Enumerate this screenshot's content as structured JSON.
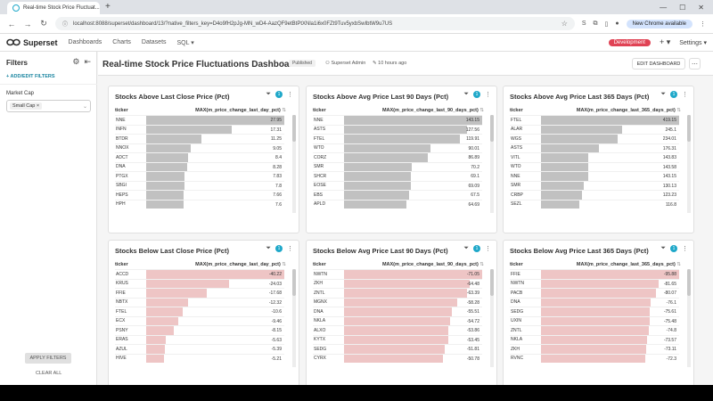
{
  "browser": {
    "tab_title": "Real-time Stock Price Fluctuat...",
    "url": "localhost:8088/superset/dashboard/13/?native_filters_key=D4o9fH2pJg-MN_wD4-AazQF9etBtPtXNla1i6x0FZt9Tuv5yxbSwIbtW9u7US",
    "new_chrome_label": "New Chrome available"
  },
  "superset": {
    "brand": "Superset",
    "menu": [
      "Dashboards",
      "Charts",
      "Datasets",
      "SQL ▾"
    ],
    "dev_badge": "Development",
    "plus_label": "+ ▾",
    "settings_label": "Settings ▾"
  },
  "filters_panel": {
    "title": "Filters",
    "add_edit": "+  ADD/EDIT FILTERS",
    "market_cap_label": "Market Cap",
    "selected_tag": "Small Cap ×",
    "apply_label": "APPLY FILTERS",
    "clear_label": "CLEAR ALL"
  },
  "dashboard": {
    "title": "Real-time Stock Price Fluctuations Dashboard",
    "status": "Published",
    "owner": "Superset Admin",
    "modified": "10 hours ago",
    "edit_label": "EDIT DASHBOARD",
    "more_label": "⋯"
  },
  "colors": {
    "positive_bar": "#c1c1c1",
    "negative_bar": "#eec5c5",
    "accent": "#1fa8c9",
    "dev_badge": "#e04355"
  },
  "charts": [
    {
      "title": "Stocks Above Last Close Price (Pct)",
      "col_ticker": "ticker",
      "col_metric": "MAX(m_price_change_last_day_pct)",
      "filter_count": "1",
      "kind": "positive",
      "rows": [
        {
          "ticker": "NNE",
          "value": "27.95"
        },
        {
          "ticker": "INFN",
          "value": "17.31"
        },
        {
          "ticker": "BTDR",
          "value": "11.25"
        },
        {
          "ticker": "NNOX",
          "value": "9.05"
        },
        {
          "ticker": "ADCT",
          "value": "8.4"
        },
        {
          "ticker": "DNA",
          "value": "8.28"
        },
        {
          "ticker": "PTGX",
          "value": "7.83"
        },
        {
          "ticker": "SBGI",
          "value": "7.8"
        },
        {
          "ticker": "HEPS",
          "value": "7.66"
        },
        {
          "ticker": "HPH",
          "value": "7.6"
        }
      ]
    },
    {
      "title": "Stocks Above Avg Price Last 90 Days (Pct)",
      "col_ticker": "ticker",
      "col_metric": "MAX(m_price_change_last_90_days_pct)",
      "filter_count": "1",
      "kind": "positive",
      "rows": [
        {
          "ticker": "NNE",
          "value": "143.15"
        },
        {
          "ticker": "ASTS",
          "value": "127.56"
        },
        {
          "ticker": "FTEL",
          "value": "119.91"
        },
        {
          "ticker": "WTO",
          "value": "90.01"
        },
        {
          "ticker": "CORZ",
          "value": "86.89"
        },
        {
          "ticker": "SMR",
          "value": "70.2"
        },
        {
          "ticker": "SHCR",
          "value": "69.1"
        },
        {
          "ticker": "EOSE",
          "value": "69.09"
        },
        {
          "ticker": "EBS",
          "value": "67.5"
        },
        {
          "ticker": "APLD",
          "value": "64.69"
        }
      ]
    },
    {
      "title": "Stocks Above Avg Price Last 365 Days (Pct)",
      "col_ticker": "ticker",
      "col_metric": "MAX(m_price_change_last_365_days_pct)",
      "filter_count": "1",
      "kind": "positive",
      "rows": [
        {
          "ticker": "FTEL",
          "value": "419.15"
        },
        {
          "ticker": "ALAR",
          "value": "245.1"
        },
        {
          "ticker": "WGS",
          "value": "234.01"
        },
        {
          "ticker": "ASTS",
          "value": "176.31"
        },
        {
          "ticker": "VITL",
          "value": "143.83"
        },
        {
          "ticker": "WTO",
          "value": "143.58"
        },
        {
          "ticker": "NNE",
          "value": "143.15"
        },
        {
          "ticker": "SMR",
          "value": "130.13"
        },
        {
          "ticker": "CRBP",
          "value": "123.23"
        },
        {
          "ticker": "SEZL",
          "value": "116.8"
        }
      ]
    },
    {
      "title": "Stocks Below Last Close Price (Pct)",
      "col_ticker": "ticker",
      "col_metric": "MAX(m_price_change_last_day_pct)",
      "filter_count": "1",
      "kind": "negative",
      "rows": [
        {
          "ticker": "ACCD",
          "value": "-40.22"
        },
        {
          "ticker": "KRUS",
          "value": "-24.03"
        },
        {
          "ticker": "FFIE",
          "value": "-17.68"
        },
        {
          "ticker": "NBTX",
          "value": "-12.32"
        },
        {
          "ticker": "FTEL",
          "value": "-10.6"
        },
        {
          "ticker": "ECX",
          "value": "-9.46"
        },
        {
          "ticker": "PSNY",
          "value": "-8.15"
        },
        {
          "ticker": "ERAS",
          "value": "-5.63"
        },
        {
          "ticker": "AZUL",
          "value": "-5.39"
        },
        {
          "ticker": "HIVE",
          "value": "-5.21"
        }
      ]
    },
    {
      "title": "Stocks Below Avg Price Last 90 Days (Pct)",
      "col_ticker": "ticker",
      "col_metric": "MAX(m_price_change_last_90_days_pct)",
      "filter_count": "1",
      "kind": "negative",
      "rows": [
        {
          "ticker": "NWTN",
          "value": "-71.05"
        },
        {
          "ticker": "ZKH",
          "value": "-64.48"
        },
        {
          "ticker": "ZNTL",
          "value": "-63.39"
        },
        {
          "ticker": "MGNX",
          "value": "-58.28"
        },
        {
          "ticker": "DNA",
          "value": "-55.51"
        },
        {
          "ticker": "NKLA",
          "value": "-54.72"
        },
        {
          "ticker": "ALXO",
          "value": "-53.86"
        },
        {
          "ticker": "KYTX",
          "value": "-53.45"
        },
        {
          "ticker": "SEDG",
          "value": "-51.81"
        },
        {
          "ticker": "CYRX",
          "value": "-50.78"
        }
      ]
    },
    {
      "title": "Stocks Below Avg Price Last 365 Days (Pct)",
      "col_ticker": "ticker",
      "col_metric": "MAX(m_price_change_last_365_days_pct)",
      "filter_count": "1",
      "kind": "negative",
      "rows": [
        {
          "ticker": "FFIE",
          "value": "-95.88"
        },
        {
          "ticker": "NWTN",
          "value": "-81.65"
        },
        {
          "ticker": "PACB",
          "value": "-80.07"
        },
        {
          "ticker": "DNA",
          "value": "-76.1"
        },
        {
          "ticker": "SEDG",
          "value": "-75.61"
        },
        {
          "ticker": "UXIN",
          "value": "-75.48"
        },
        {
          "ticker": "ZNTL",
          "value": "-74.8"
        },
        {
          "ticker": "NKLA",
          "value": "-73.57"
        },
        {
          "ticker": "ZKH",
          "value": "-73.11"
        },
        {
          "ticker": "RVNC",
          "value": "-72.3"
        }
      ]
    }
  ]
}
